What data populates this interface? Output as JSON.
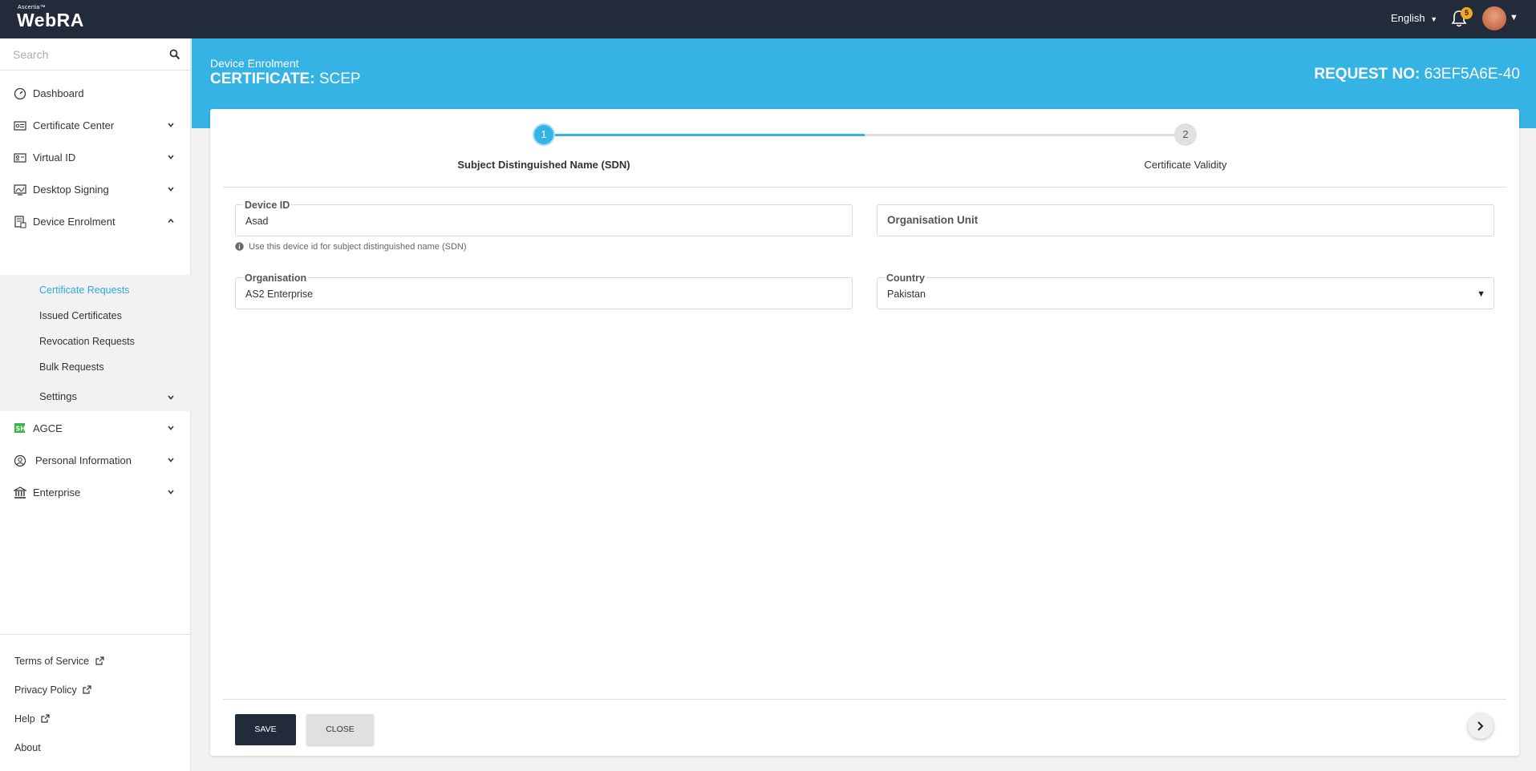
{
  "topbar": {
    "brand_small": "Ascertia™",
    "brand": "WebRA",
    "language": "English",
    "notification_count": "5"
  },
  "sidebar": {
    "search_placeholder": "Search",
    "items": [
      {
        "label": "Dashboard",
        "icon": "dashboard-icon"
      },
      {
        "label": "Certificate Center",
        "icon": "certificate-icon"
      },
      {
        "label": "Virtual ID",
        "icon": "id-card-icon"
      },
      {
        "label": "Desktop Signing",
        "icon": "signing-icon"
      },
      {
        "label": "Device Enrolment",
        "icon": "device-icon"
      },
      {
        "label": "AGCE",
        "icon": "agce-icon"
      },
      {
        "label": "Personal Information",
        "icon": "user-circle-icon"
      },
      {
        "label": "Enterprise",
        "icon": "bank-icon"
      }
    ],
    "submenu": [
      {
        "label": "Certificate Requests"
      },
      {
        "label": "Issued Certificates"
      },
      {
        "label": "Revocation Requests"
      },
      {
        "label": "Bulk Requests"
      },
      {
        "label": "Settings"
      }
    ],
    "footer": [
      {
        "label": "Terms of Service"
      },
      {
        "label": "Privacy Policy"
      },
      {
        "label": "Help"
      },
      {
        "label": "About"
      }
    ]
  },
  "header": {
    "breadcrumb": "Device Enrolment",
    "title_prefix": "CERTIFICATE:",
    "title_value": "SCEP",
    "request_prefix": "REQUEST NO:",
    "request_value": "63EF5A6E-40"
  },
  "stepper": {
    "steps": [
      {
        "number": "1",
        "label": "Subject Distinguished Name (SDN)"
      },
      {
        "number": "2",
        "label": "Certificate Validity"
      }
    ]
  },
  "form": {
    "device_id": {
      "label": "Device ID",
      "value": "Asad",
      "hint": "Use this device id for subject distinguished name (SDN)"
    },
    "org_unit": {
      "label": "Organisation Unit"
    },
    "organisation": {
      "label": "Organisation",
      "value": "AS2 Enterprise"
    },
    "country": {
      "label": "Country",
      "value": "Pakistan"
    }
  },
  "actions": {
    "save": "SAVE",
    "close": "CLOSE"
  },
  "colors": {
    "topbar": "#222b3a",
    "accent": "#34b3e4",
    "badge": "#f5a623"
  }
}
